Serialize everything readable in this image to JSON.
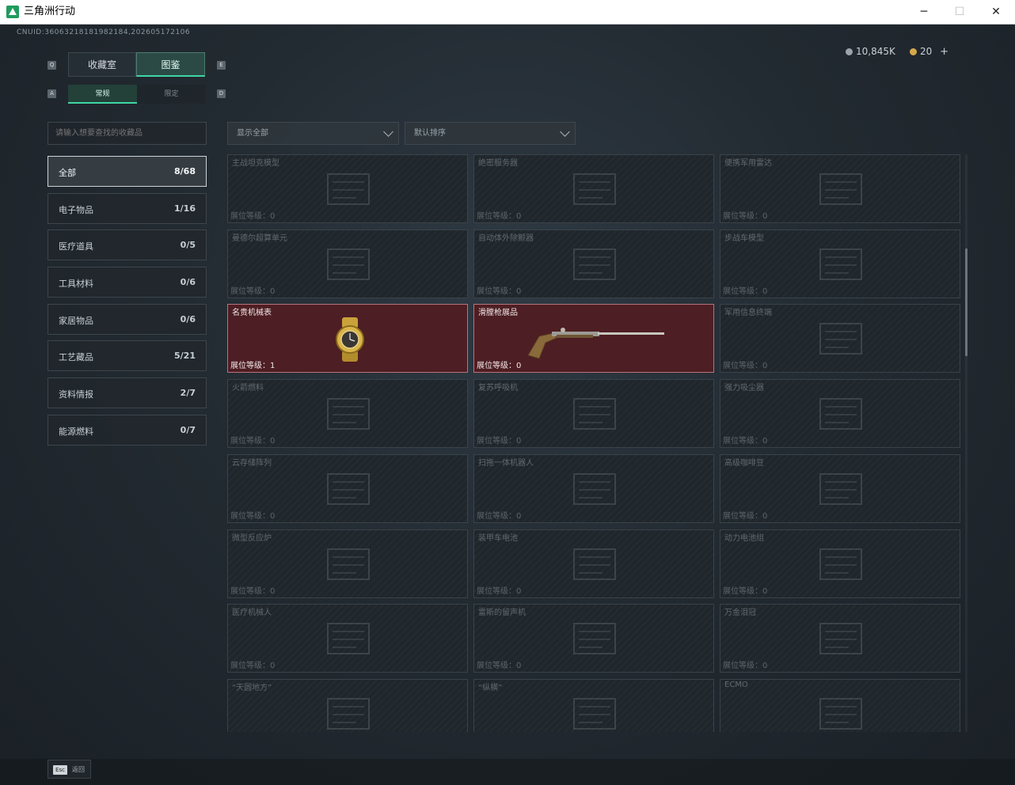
{
  "window": {
    "title": "三角洲行动",
    "minimize": "─",
    "maximize": "☐",
    "close": "✕"
  },
  "header": {
    "uid": "CNUID:36063218181982184,202605172106",
    "currency1": "10,845K",
    "currency2": "20",
    "add": "+"
  },
  "tabs": [
    {
      "label": "收藏室"
    },
    {
      "label": "图鉴"
    }
  ],
  "tab_keys": {
    "left": "Q",
    "right": "E"
  },
  "subtabs": [
    {
      "label": "常规"
    },
    {
      "label": "限定"
    }
  ],
  "subtab_keys": {
    "left": "A",
    "right": "D"
  },
  "search": {
    "placeholder": "请输入想要查找的收藏品"
  },
  "filters": {
    "show": "显示全部",
    "sort": "默认排序"
  },
  "categories": [
    {
      "label": "全部",
      "count": "8/68"
    },
    {
      "label": "电子物品",
      "count": "1/16"
    },
    {
      "label": "医疗道具",
      "count": "0/5"
    },
    {
      "label": "工具材料",
      "count": "0/6"
    },
    {
      "label": "家居物品",
      "count": "0/6"
    },
    {
      "label": "工艺藏品",
      "count": "5/21"
    },
    {
      "label": "资料情报",
      "count": "2/7"
    },
    {
      "label": "能源燃料",
      "count": "0/7"
    }
  ],
  "items": [
    {
      "name": "主战坦克模型",
      "level": "展位等级：0"
    },
    {
      "name": "绝密服务器",
      "level": "展位等级：0"
    },
    {
      "name": "便携军用雷达",
      "level": "展位等级：0"
    },
    {
      "name": "曼德尔超算单元",
      "level": "展位等级：0"
    },
    {
      "name": "自动体外除颤器",
      "level": "展位等级：0"
    },
    {
      "name": "步战车模型",
      "level": "展位等级：0"
    },
    {
      "name": "名贵机械表",
      "level": "展位等级：1",
      "owned": true
    },
    {
      "name": "滑膛枪展品",
      "level": "展位等级：0",
      "owned": true
    },
    {
      "name": "军用信息终端",
      "level": "展位等级：0"
    },
    {
      "name": "火箭燃料",
      "level": "展位等级：0"
    },
    {
      "name": "复苏呼吸机",
      "level": "展位等级：0"
    },
    {
      "name": "强力吸尘器",
      "level": "展位等级：0"
    },
    {
      "name": "云存储阵列",
      "level": "展位等级：0"
    },
    {
      "name": "扫拖一体机器人",
      "level": "展位等级：0"
    },
    {
      "name": "高级咖啡豆",
      "level": "展位等级：0"
    },
    {
      "name": "微型反应炉",
      "level": "展位等级：0"
    },
    {
      "name": "装甲车电池",
      "level": "展位等级：0"
    },
    {
      "name": "动力电池组",
      "level": "展位等级：0"
    },
    {
      "name": "医疗机械人",
      "level": "展位等级：0"
    },
    {
      "name": "雷斯的留声机",
      "level": "展位等级：0"
    },
    {
      "name": "万金泪冠",
      "level": "展位等级：0"
    },
    {
      "name": "“天圆地方”",
      "level": ""
    },
    {
      "name": "“纵横”",
      "level": ""
    },
    {
      "name": "ECMO",
      "level": ""
    }
  ],
  "footer": {
    "esc_key": "Esc",
    "esc_label": "返回"
  },
  "colors": {
    "accent": "#3fd6a6",
    "owned": "#4d1e23"
  }
}
